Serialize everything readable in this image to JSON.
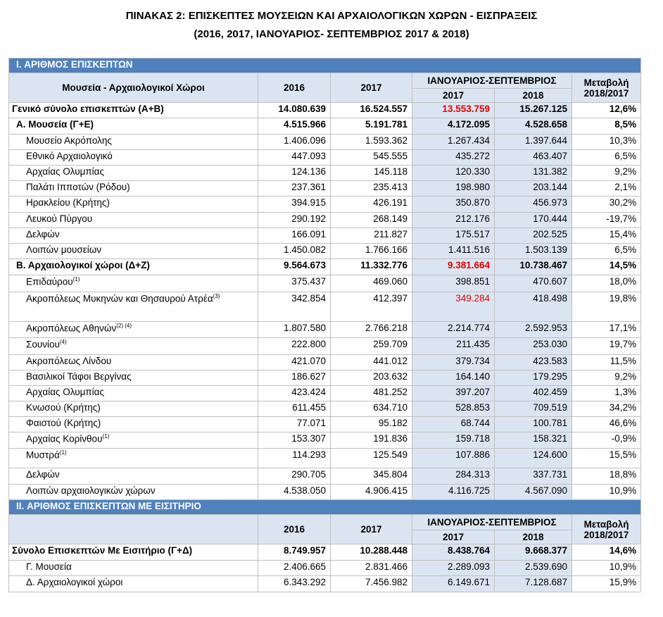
{
  "title_line1": "ΠΙΝΑΚΑΣ 2: ΕΠΙΣΚΕΠΤΕΣ ΜΟΥΣΕΙΩΝ ΚΑΙ ΑΡΧΑΙΟΛΟΓΙΚΩΝ ΧΩΡΩΝ - ΕΙΣΠΡΑΞΕΙΣ",
  "title_line2": "(2016, 2017, ΙΑΝΟΥΑΡΙΟΣ- ΣΕΠΤΕΜΒΡΙΟΣ 2017 & 2018)",
  "section1": {
    "band": "I. ΑΡΙΘΜΟΣ  ΕΠΙΣΚΕΠΤΩΝ",
    "header": {
      "label": "Μουσεία - Αρχαιολογικοί Χώροι",
      "y2016": "2016",
      "y2017": "2017",
      "period": "ΙΑΝΟΥΑΡΙΟΣ-ΣΕΠΤΕΜΒΡΙΟΣ",
      "p2017": "2017",
      "p2018": "2018",
      "change1": "Μεταβολή",
      "change2": "2018/2017"
    },
    "rows": [
      {
        "name": "Γενικό  σύνολο επισκεπτών (Α+Β)",
        "sup": "",
        "v2016": "14.080.639",
        "v2017": "16.524.557",
        "p2017": "13.553.759",
        "p2018": "15.267.125",
        "change": "12,6%"
      },
      {
        "name": "Α. Μουσεία (Γ+Ε)",
        "sup": "",
        "v2016": "4.515.966",
        "v2017": "5.191.781",
        "p2017": "4.172.095",
        "p2018": "4.528.658",
        "change": "8,5%"
      },
      {
        "name": "Μουσείο Ακρόπολης",
        "sup": "",
        "v2016": "1.406.096",
        "v2017": "1.593.362",
        "p2017": "1.267.434",
        "p2018": "1.397.644",
        "change": "10,3%"
      },
      {
        "name": "Εθνικό Αρχαιολογικό",
        "sup": "",
        "v2016": "447.093",
        "v2017": "545.555",
        "p2017": "435.272",
        "p2018": "463.407",
        "change": "6,5%"
      },
      {
        "name": "Αρχαίας Ολυμπίας",
        "sup": "",
        "v2016": "124.136",
        "v2017": "145.118",
        "p2017": "120.330",
        "p2018": "131.382",
        "change": "9,2%"
      },
      {
        "name": "Παλάτι Ιπποτών (Ρόδου)",
        "sup": "",
        "v2016": "237.361",
        "v2017": "235.413",
        "p2017": "198.980",
        "p2018": "203.144",
        "change": "2,1%"
      },
      {
        "name": "Ηρακλείου (Κρήτης)",
        "sup": "",
        "v2016": "394.915",
        "v2017": "426.191",
        "p2017": "350.870",
        "p2018": "456.973",
        "change": "30,2%"
      },
      {
        "name": "Λευκού Πύργου",
        "sup": "",
        "v2016": "290.192",
        "v2017": "268.149",
        "p2017": "212.176",
        "p2018": "170.444",
        "change": "-19,7%"
      },
      {
        "name": "Δελφών",
        "sup": "",
        "v2016": "166.091",
        "v2017": "211.827",
        "p2017": "175.517",
        "p2018": "202.525",
        "change": "15,4%"
      },
      {
        "name": "Λοιπών μουσείων",
        "sup": "",
        "v2016": "1.450.082",
        "v2017": "1.766.166",
        "p2017": "1.411.516",
        "p2018": "1.503.139",
        "change": "6,5%"
      },
      {
        "name": "Β. Αρχαιολογικοί χώροι (Δ+Ζ)",
        "sup": "",
        "v2016": "9.564.673",
        "v2017": "11.332.776",
        "p2017": "9.381.664",
        "p2018": "10.738.467",
        "change": "14,5%"
      },
      {
        "name": "Επιδαύρου",
        "sup": "(1)",
        "v2016": "375.437",
        "v2017": "469.060",
        "p2017": "398.851",
        "p2018": "470.607",
        "change": "18,0%"
      },
      {
        "name": "Ακροπόλεως Μυκηνών και Θησαυρού Ατρέα",
        "sup": "(3)",
        "v2016": "342.854",
        "v2017": "412.397",
        "p2017": "349.284",
        "p2018": "418.498",
        "change": "19,8%"
      },
      {
        "name": "Ακροπόλεως Αθηνών",
        "sup": "(2) (4)",
        "v2016": "1.807.580",
        "v2017": "2.766.218",
        "p2017": "2.214.774",
        "p2018": "2.592.953",
        "change": "17,1%"
      },
      {
        "name": "Σουνίου",
        "sup": "(4)",
        "v2016": "222.800",
        "v2017": "259.709",
        "p2017": "211.435",
        "p2018": "253.030",
        "change": "19,7%"
      },
      {
        "name": "Ακροπόλεως Λίνδου",
        "sup": "",
        "v2016": "421.070",
        "v2017": "441.012",
        "p2017": "379.734",
        "p2018": "423.583",
        "change": "11,5%"
      },
      {
        "name": "Βασιλικοί Τάφοι Βεργίνας",
        "sup": "",
        "v2016": "186.627",
        "v2017": "203.632",
        "p2017": "164.140",
        "p2018": "179.295",
        "change": "9,2%"
      },
      {
        "name": "Αρχαίας Ολυμπίας",
        "sup": "",
        "v2016": "423.424",
        "v2017": "481.252",
        "p2017": "397.207",
        "p2018": "402.459",
        "change": "1,3%"
      },
      {
        "name": "Κνωσού (Κρήτης)",
        "sup": "",
        "v2016": "611.455",
        "v2017": "634.710",
        "p2017": "528.853",
        "p2018": "709.519",
        "change": "34,2%"
      },
      {
        "name": "Φαιστού (Κρήτης)",
        "sup": "",
        "v2016": "77.071",
        "v2017": "95.182",
        "p2017": "68.744",
        "p2018": "100.781",
        "change": "46,6%"
      },
      {
        "name": "Αρχαίας Κορίνθου",
        "sup": "(1)",
        "v2016": "153.307",
        "v2017": "191.836",
        "p2017": "159.718",
        "p2018": "158.321",
        "change": "-0,9%"
      },
      {
        "name": "Μυστρά",
        "sup": "(1)",
        "v2016": "114.293",
        "v2017": "125.549",
        "p2017": "107.886",
        "p2018": "124.600",
        "change": "15,5%"
      },
      {
        "name": "Δελφών",
        "sup": "",
        "v2016": "290.705",
        "v2017": "345.804",
        "p2017": "284.313",
        "p2018": "337.731",
        "change": "18,8%"
      },
      {
        "name": "Λοιπών αρχαιολογικών χώρων",
        "sup": "",
        "v2016": "4.538.050",
        "v2017": "4.906.415",
        "p2017": "4.116.725",
        "p2018": "4.567.090",
        "change": "10,9%"
      }
    ]
  },
  "section2": {
    "band": "II. ΑΡΙΘΜΟΣ  ΕΠΙΣΚΕΠΤΩΝ  ΜΕ ΕΙΣΙΤΗΡΙΟ",
    "header": {
      "y2016": "2016",
      "y2017": "2017",
      "period": "ΙΑΝΟΥΑΡΙΟΣ-ΣΕΠΤΕΜΒΡΙΟΣ",
      "p2017": "2017",
      "p2018": "2018",
      "change1": "Μεταβολή",
      "change2": "2018/2017"
    },
    "rows": [
      {
        "name": "Σύνολο Επισκεπτών Με Εισιτήριο (Γ+Δ)",
        "sup": "",
        "v2016": "8.749.957",
        "v2017": "10.288.448",
        "p2017": "8.438.764",
        "p2018": "9.668.377",
        "change": "14,6%"
      },
      {
        "name": "Γ. Μουσεία",
        "sup": "",
        "v2016": "2.406.665",
        "v2017": "2.831.466",
        "p2017": "2.289.093",
        "p2018": "2.539.690",
        "change": "10,9%"
      },
      {
        "name": "Δ. Αρχαιολογικοί χώροι",
        "sup": "",
        "v2016": "6.343.292",
        "v2017": "7.456.982",
        "p2017": "6.149.671",
        "p2018": "7.128.687",
        "change": "15,9%"
      }
    ]
  },
  "colors": {
    "band": "#4f81bd",
    "shade": "#dbe5f1",
    "highlight": "#e00000"
  }
}
